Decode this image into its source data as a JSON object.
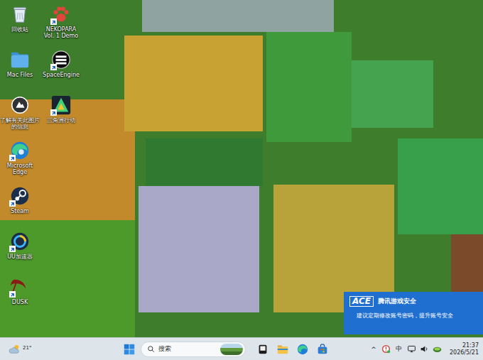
{
  "desktop": {
    "icons": [
      {
        "label": "回收站",
        "kind": "recycle",
        "shortcut": false
      },
      {
        "label": "Mac Files",
        "kind": "mac-folder",
        "shortcut": false
      },
      {
        "label": "了解有关此图片的信息",
        "kind": "spotlight",
        "shortcut": false
      },
      {
        "label": "Microsoft Edge",
        "kind": "edge",
        "shortcut": true
      },
      {
        "label": "Steam",
        "kind": "steam",
        "shortcut": true
      },
      {
        "label": "UU加速器",
        "kind": "uu",
        "shortcut": true
      },
      {
        "label": "DUSK",
        "kind": "dusk",
        "shortcut": true
      },
      {
        "label": "NEKOPARA Vol. 1 Demo",
        "kind": "paw",
        "shortcut": true
      },
      {
        "label": "SpaceEngine",
        "kind": "spaceengine",
        "shortcut": true
      },
      {
        "label": "三角洲行动",
        "kind": "delta",
        "shortcut": true
      }
    ]
  },
  "notification": {
    "logo": "ACE",
    "title": "腾讯游戏安全",
    "message": "建议定期修改账号密码，提升账号安全"
  },
  "taskbar": {
    "weather": {
      "temperature": "21°"
    },
    "search": {
      "placeholder": "搜索"
    },
    "pinned": [
      {
        "kind": "task-view"
      },
      {
        "kind": "file-explorer"
      },
      {
        "kind": "edge"
      },
      {
        "kind": "store"
      }
    ],
    "tray": {
      "overflow": "^",
      "icons": [
        {
          "kind": "security"
        },
        {
          "kind": "ime",
          "label": "中"
        },
        {
          "kind": "wifi"
        },
        {
          "kind": "volume"
        },
        {
          "kind": "game-app"
        }
      ],
      "time": "21:37",
      "date": "2026/5/21"
    }
  }
}
